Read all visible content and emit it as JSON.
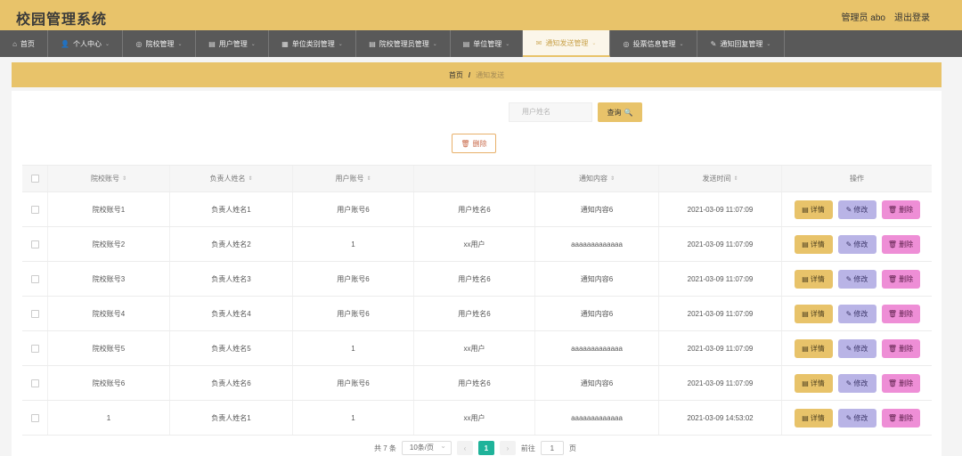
{
  "header": {
    "title": "校园管理系统",
    "admin": "管理员 abo",
    "logout": "退出登录"
  },
  "nav": [
    {
      "icon": "⌂",
      "label": "首页",
      "caret": ""
    },
    {
      "icon": "👤",
      "label": "个人中心",
      "caret": "⌄"
    },
    {
      "icon": "◎",
      "label": "院校管理",
      "caret": "⌄"
    },
    {
      "icon": "▤",
      "label": "用户管理",
      "caret": "⌄"
    },
    {
      "icon": "▦",
      "label": "单位类别管理",
      "caret": "⌄"
    },
    {
      "icon": "▤",
      "label": "院校管理员管理",
      "caret": "⌄"
    },
    {
      "icon": "▤",
      "label": "单位管理",
      "caret": "⌄"
    },
    {
      "icon": "✉",
      "label": "通知发送管理",
      "caret": "⌄"
    },
    {
      "icon": "◎",
      "label": "投票信息管理",
      "caret": "⌄"
    },
    {
      "icon": "✎",
      "label": "通知回复管理",
      "caret": "⌄"
    }
  ],
  "breadcrumb": {
    "home": "首页",
    "sep": "/",
    "current": "通知发送"
  },
  "search": {
    "placeholder": "用户姓名",
    "button": "查询",
    "button_icon": "🔍"
  },
  "bulk_delete": {
    "icon": "🗑",
    "label": "删除"
  },
  "table": {
    "headers": [
      "院校账号",
      "负责人姓名",
      "用户账号",
      "",
      "通知内容",
      "发送时间",
      "操作"
    ],
    "sort_icon": "⇕",
    "actions": {
      "detail": "详情",
      "edit": "修改",
      "remove": "删除",
      "detail_icon": "▤",
      "edit_icon": "✎",
      "remove_icon": "🗑"
    },
    "rows": [
      [
        "院校账号1",
        "负责人姓名1",
        "用户账号6",
        "用户姓名6",
        "通知内容6",
        "2021-03-09 11:07:09"
      ],
      [
        "院校账号2",
        "负责人姓名2",
        "1",
        "xx用户",
        "aaaaaaaaaaaaa",
        "2021-03-09 11:07:09"
      ],
      [
        "院校账号3",
        "负责人姓名3",
        "用户账号6",
        "用户姓名6",
        "通知内容6",
        "2021-03-09 11:07:09"
      ],
      [
        "院校账号4",
        "负责人姓名4",
        "用户账号6",
        "用户姓名6",
        "通知内容6",
        "2021-03-09 11:07:09"
      ],
      [
        "院校账号5",
        "负责人姓名5",
        "1",
        "xx用户",
        "aaaaaaaaaaaaa",
        "2021-03-09 11:07:09"
      ],
      [
        "院校账号6",
        "负责人姓名6",
        "用户账号6",
        "用户姓名6",
        "通知内容6",
        "2021-03-09 11:07:09"
      ],
      [
        "1",
        "负责人姓名1",
        "1",
        "xx用户",
        "aaaaaaaaaaaaa",
        "2021-03-09 14:53:02"
      ]
    ]
  },
  "pagination": {
    "total": "共 7 条",
    "page_size": "10条/页",
    "prev": "‹",
    "page": "1",
    "next": "›",
    "goto_label": "前往",
    "goto_value": "1",
    "goto_suffix": "页"
  }
}
